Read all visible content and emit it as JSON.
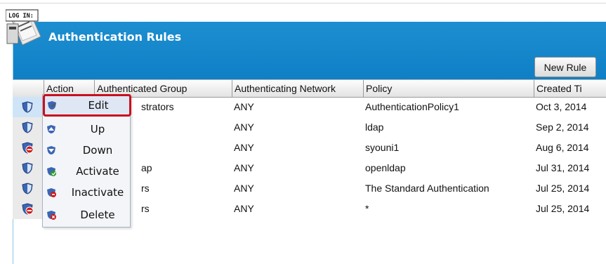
{
  "panel": {
    "title": "Authentication Rules",
    "new_rule_label": "New Rule",
    "login_icon_label": "LOG IN:"
  },
  "table": {
    "columns": [
      "Action",
      "Authenticated Group",
      "Authenticating Network",
      "Policy",
      "Created Ti"
    ],
    "rows": [
      {
        "group": "strators",
        "network": "ANY",
        "policy": "AuthenticationPolicy1",
        "created": "Oct 3, 2014",
        "status": "enabled"
      },
      {
        "group": "",
        "network": "ANY",
        "policy": "ldap",
        "created": "Sep 2, 2014",
        "status": "enabled"
      },
      {
        "group": "",
        "network": "ANY",
        "policy": "syouni1",
        "created": "Aug 6, 2014",
        "status": "disabled"
      },
      {
        "group": "ap",
        "network": "ANY",
        "policy": "openldap",
        "created": "Jul 31, 2014",
        "status": "enabled"
      },
      {
        "group": "rs",
        "network": "ANY",
        "policy": "The Standard Authentication",
        "created": "Jul 25, 2014",
        "status": "enabled"
      },
      {
        "group": "rs",
        "network": "ANY",
        "policy": "*",
        "created": "Jul 25, 2014",
        "status": "disabled"
      }
    ]
  },
  "menu": {
    "items": [
      {
        "label": "Edit",
        "icon": "edit-icon"
      },
      {
        "label": "Up",
        "icon": "up-icon"
      },
      {
        "label": "Down",
        "icon": "down-icon"
      },
      {
        "label": "Activate",
        "icon": "activate-icon"
      },
      {
        "label": "Inactivate",
        "icon": "inactivate-icon"
      },
      {
        "label": "Delete",
        "icon": "delete-icon"
      }
    ]
  },
  "colors": {
    "header_blue": "#1686cb",
    "highlight_red": "#c8101e",
    "selected_row": "#cfe4f6"
  }
}
